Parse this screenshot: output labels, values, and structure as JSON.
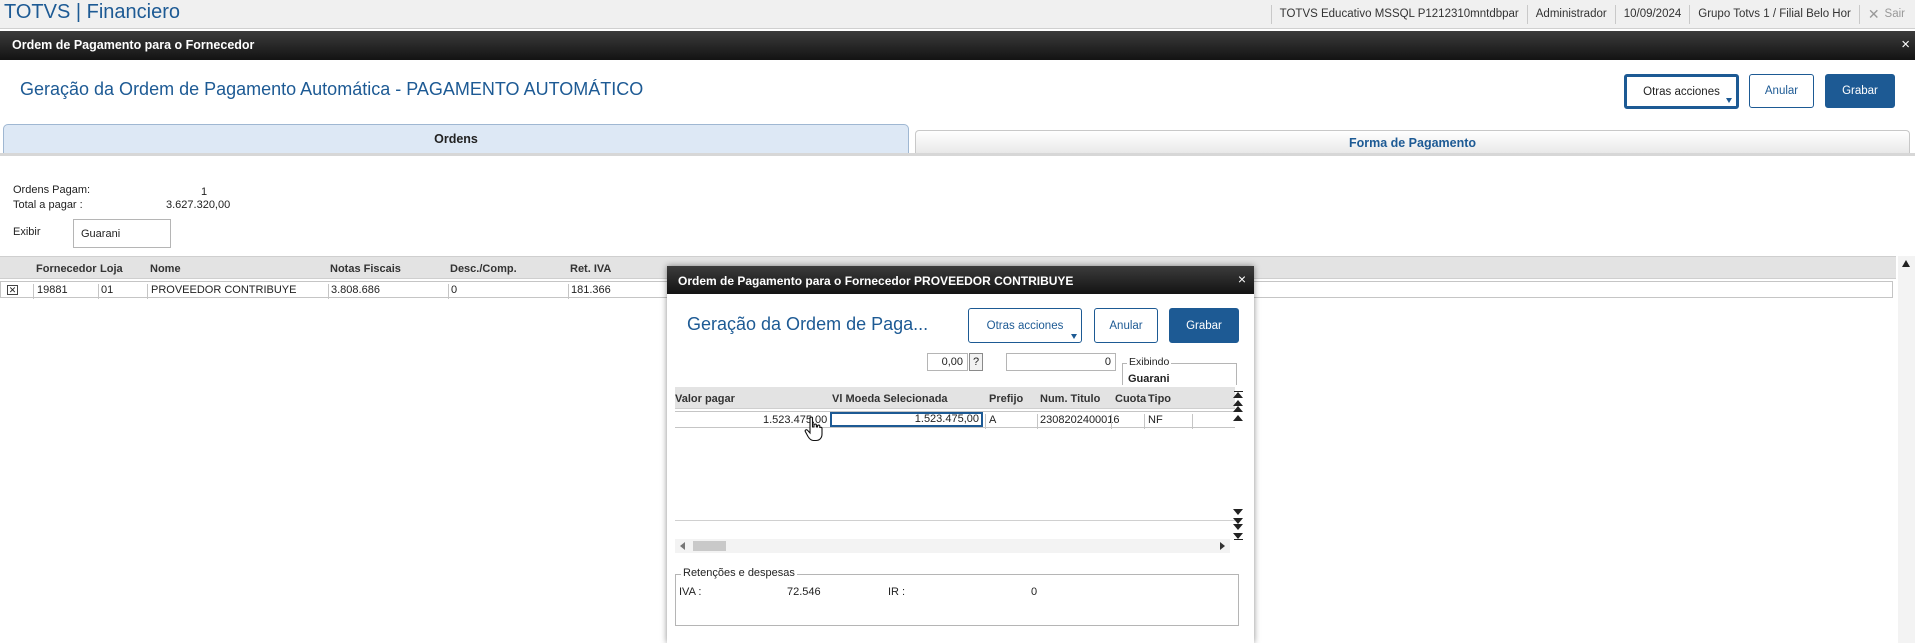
{
  "topbar": {
    "app_title": "TOTVS | Financiero",
    "environment": "TOTVS Educativo MSSQL P1212310mntdbpar",
    "user": "Administrador",
    "date": "10/09/2024",
    "branch": "Grupo Totvs 1 / Filial Belo Hor",
    "exit_label": "Sair"
  },
  "window": {
    "title": "Ordem de Pagamento para o Fornecedor",
    "page_title": "Geração da Ordem de Pagamento Automática - PAGAMENTO AUTOMÁTICO",
    "buttons": {
      "other": "Otras acciones",
      "cancel": "Anular",
      "save": "Grabar"
    },
    "tabs": [
      "Ordens",
      "Forma de Pagamento"
    ]
  },
  "summary": {
    "orders_label": "Ordens Pagam:",
    "orders_value": "1",
    "total_label": "Total a pagar :",
    "total_value": "3.627.320,00",
    "show_label": "Exibir",
    "show_value": "Guarani"
  },
  "grid": {
    "columns": [
      "Fornecedor",
      "Loja",
      "Nome",
      "Notas Fiscais",
      "Desc./Comp.",
      "Ret. IVA"
    ],
    "rows": [
      {
        "checked": true,
        "fornecedor": "19881",
        "loja": "01",
        "nome": "PROVEEDOR CONTRIBUYE",
        "notas": "3.808.686",
        "desc": "0",
        "ret_iva": "181.366"
      }
    ]
  },
  "modal": {
    "title": "Ordem de Pagamento para o Fornecedor PROVEEDOR CONTRIBUYE",
    "page_title": "Geração da Ordem de Paga...",
    "buttons": {
      "other": "Otras acciones",
      "cancel": "Anular",
      "save": "Grabar"
    },
    "field1_value": "0,00",
    "help": "?",
    "field2_value": "0",
    "exibindo_label": "Exibindo",
    "exibindo_value": "Guarani",
    "columns": [
      "Valor pagar",
      "Vl Moeda Selecionada",
      "Prefijo",
      "Num. Titulo",
      "Cuota",
      "Tipo"
    ],
    "rows": [
      {
        "valor_pagar": "1.523.475,00",
        "vl_moeda": "1.523.475,00",
        "prefijo": "A",
        "num_titulo": "2308202400016",
        "cuota": "",
        "tipo": "NF"
      }
    ],
    "retencoes": {
      "legend": "Retenções e despesas",
      "iva_label": "IVA :",
      "iva_value": "72.546",
      "ir_label": "IR :",
      "ir_value": "0"
    }
  },
  "colors": {
    "brand": "#1d5a94",
    "header_dark": "#1a1a1a"
  }
}
